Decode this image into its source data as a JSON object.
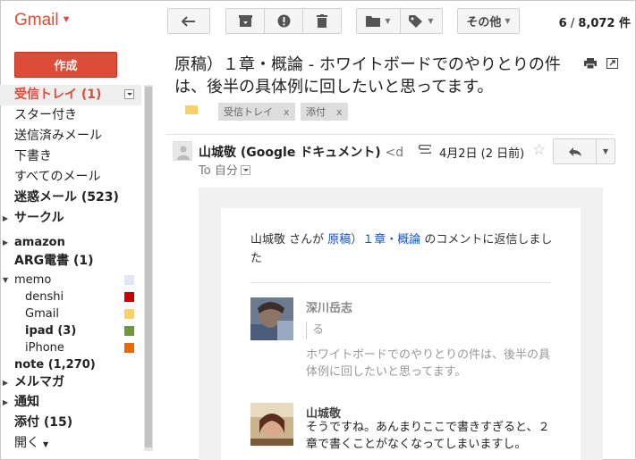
{
  "app": {
    "logo": "Gmail"
  },
  "toolbar": {
    "more_label": "その他",
    "count_current": "6",
    "count_sep": " / ",
    "count_total": "8,072 件"
  },
  "sidebar": {
    "compose_label": "作成",
    "items": [
      {
        "label": "受信トレイ (1)"
      },
      {
        "label": "スター付き"
      },
      {
        "label": "送信済みメール"
      },
      {
        "label": "下書き"
      },
      {
        "label": "すべてのメール"
      },
      {
        "label": "迷惑メール (523)"
      },
      {
        "label": "サークル"
      },
      {
        "label": "amazon"
      },
      {
        "label": "ARG電書 (1)"
      },
      {
        "label": "memo"
      },
      {
        "label": "denshi"
      },
      {
        "label": "Gmail"
      },
      {
        "label": "ipad (3)"
      },
      {
        "label": "iPhone"
      },
      {
        "label": "note (1,270)"
      },
      {
        "label": "メルマガ"
      },
      {
        "label": "通知"
      },
      {
        "label": "添付 (15)"
      },
      {
        "label": "開く"
      }
    ],
    "swatch_colors": {
      "memo": "#dfe6f5",
      "denshi": "#cc0000",
      "Gmail": "#fad165",
      "ipad": "#6b9b37",
      "iPhone": "#e66b00"
    }
  },
  "message": {
    "subject": "原稿）１章・概論 - ホワイトボードでのやりとりの件は、後半の具体例に回したいと思ってます。",
    "labels": [
      {
        "name": "受信トレイ",
        "remove": "x"
      },
      {
        "name": "添付",
        "remove": "x"
      }
    ],
    "sender_name": "山城敬 (Google ドキュメント)",
    "sender_addr": "<d",
    "to": "To 自分",
    "date": "4月2日 (2 日前)"
  },
  "card": {
    "title_prefix": "山城敬 さんが ",
    "title_link": "原稿）１章・概論",
    "title_suffix": " のコメントに返信しました",
    "comments": [
      {
        "name": "深川岳志",
        "quote": "る",
        "text": "ホワイトボードでのやりとりの件は、後半の具体例に回したいと思ってます。"
      },
      {
        "name": "山城敬",
        "text": "そうですね。あんまりここで書きすぎると、２章で書くことがなくなってしまいますし。"
      }
    ]
  },
  "colors": {
    "brand": "#dd4b39",
    "link": "#1155cc"
  }
}
